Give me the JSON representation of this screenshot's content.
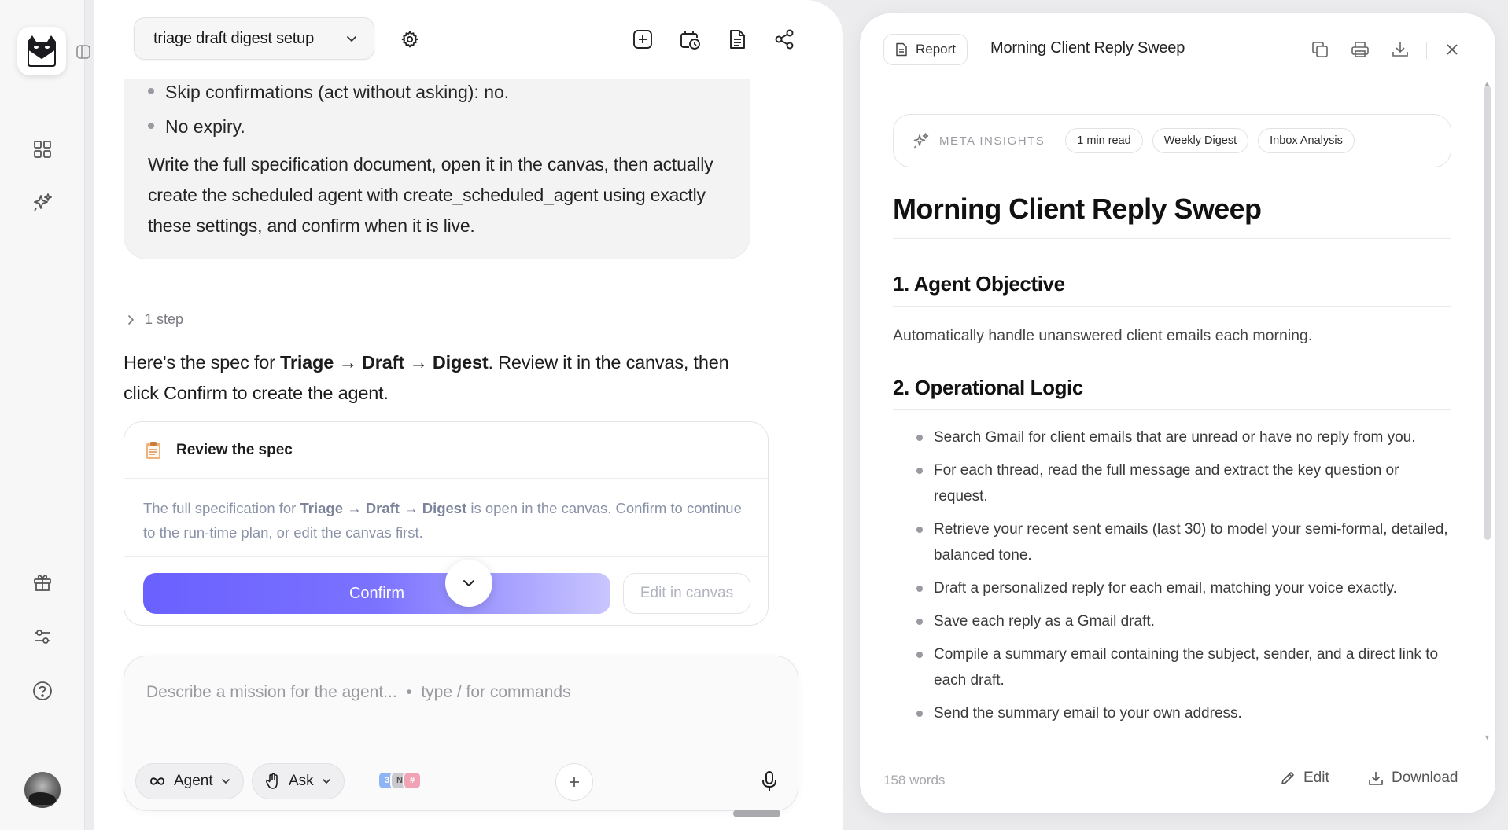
{
  "session": {
    "title": "triage draft digest setup"
  },
  "prompt": {
    "bullets": [
      "Skip confirmations (act without asking): no.",
      "No expiry."
    ],
    "paragraph": "Write the full specification document, open it in the canvas, then actually create the scheduled agent with create_scheduled_agent using exactly these settings, and confirm when it is live."
  },
  "steps": {
    "label": "1 step"
  },
  "assistant": {
    "pre": "Here's the spec for ",
    "name_1": "Triage",
    "arrow_1": " → ",
    "name_2": "Draft",
    "arrow_2": " → ",
    "name_3": "Digest",
    "post": ". Review it in the canvas, then click Confirm to create the agent."
  },
  "spec_card": {
    "title": "Review the spec",
    "body_pre": "The full specification for ",
    "body_name": "Triage → Draft → Digest",
    "body_post": " is open in the canvas. Confirm to continue to the run-time plan, or edit the canvas first.",
    "confirm_label": "Confirm",
    "edit_label": "Edit in canvas"
  },
  "composer": {
    "placeholder": "Describe a mission for the agent...  •  type / for commands",
    "agent_label": "Agent",
    "ask_label": "Ask"
  },
  "report": {
    "tag": "Report",
    "top_title": "Morning Client Reply Sweep",
    "meta_label": "META INSIGHTS",
    "chips": [
      "1 min read",
      "Weekly Digest",
      "Inbox Analysis"
    ],
    "heading": "Morning Client Reply Sweep",
    "section1_title": "1. Agent Objective",
    "section1_text": "Automatically handle unanswered client emails each morning.",
    "section2_title": "2. Operational Logic",
    "section2_items": [
      "Search Gmail for client emails that are unread or have no reply from you.",
      "For each thread, read the full message and extract the key question or request.",
      "Retrieve your recent sent emails (last 30) to model your semi-formal, detailed, balanced tone.",
      "Draft a personalized reply for each email, matching your voice exactly.",
      "Save each reply as a Gmail draft.",
      "Compile a summary email containing the subject, sender, and a direct link to each draft.",
      "Send the summary email to your own address."
    ],
    "word_count": "158 words",
    "edit_label": "Edit",
    "download_label": "Download"
  },
  "colors": {
    "accent": "#6a60ff",
    "accent_light": "#c9c6ff"
  },
  "icons": {
    "rail": [
      "logo-mail-cat-icon",
      "sidebar-toggle-icon",
      "grid-icon",
      "sparkle-icon",
      "gift-icon",
      "sliders-icon",
      "help-icon"
    ],
    "header": [
      "settings-icon",
      "new-chat-icon",
      "scheduled-icon",
      "document-icon",
      "share-icon"
    ],
    "report": [
      "copy-icon",
      "print-icon",
      "download-icon",
      "close-icon"
    ]
  }
}
